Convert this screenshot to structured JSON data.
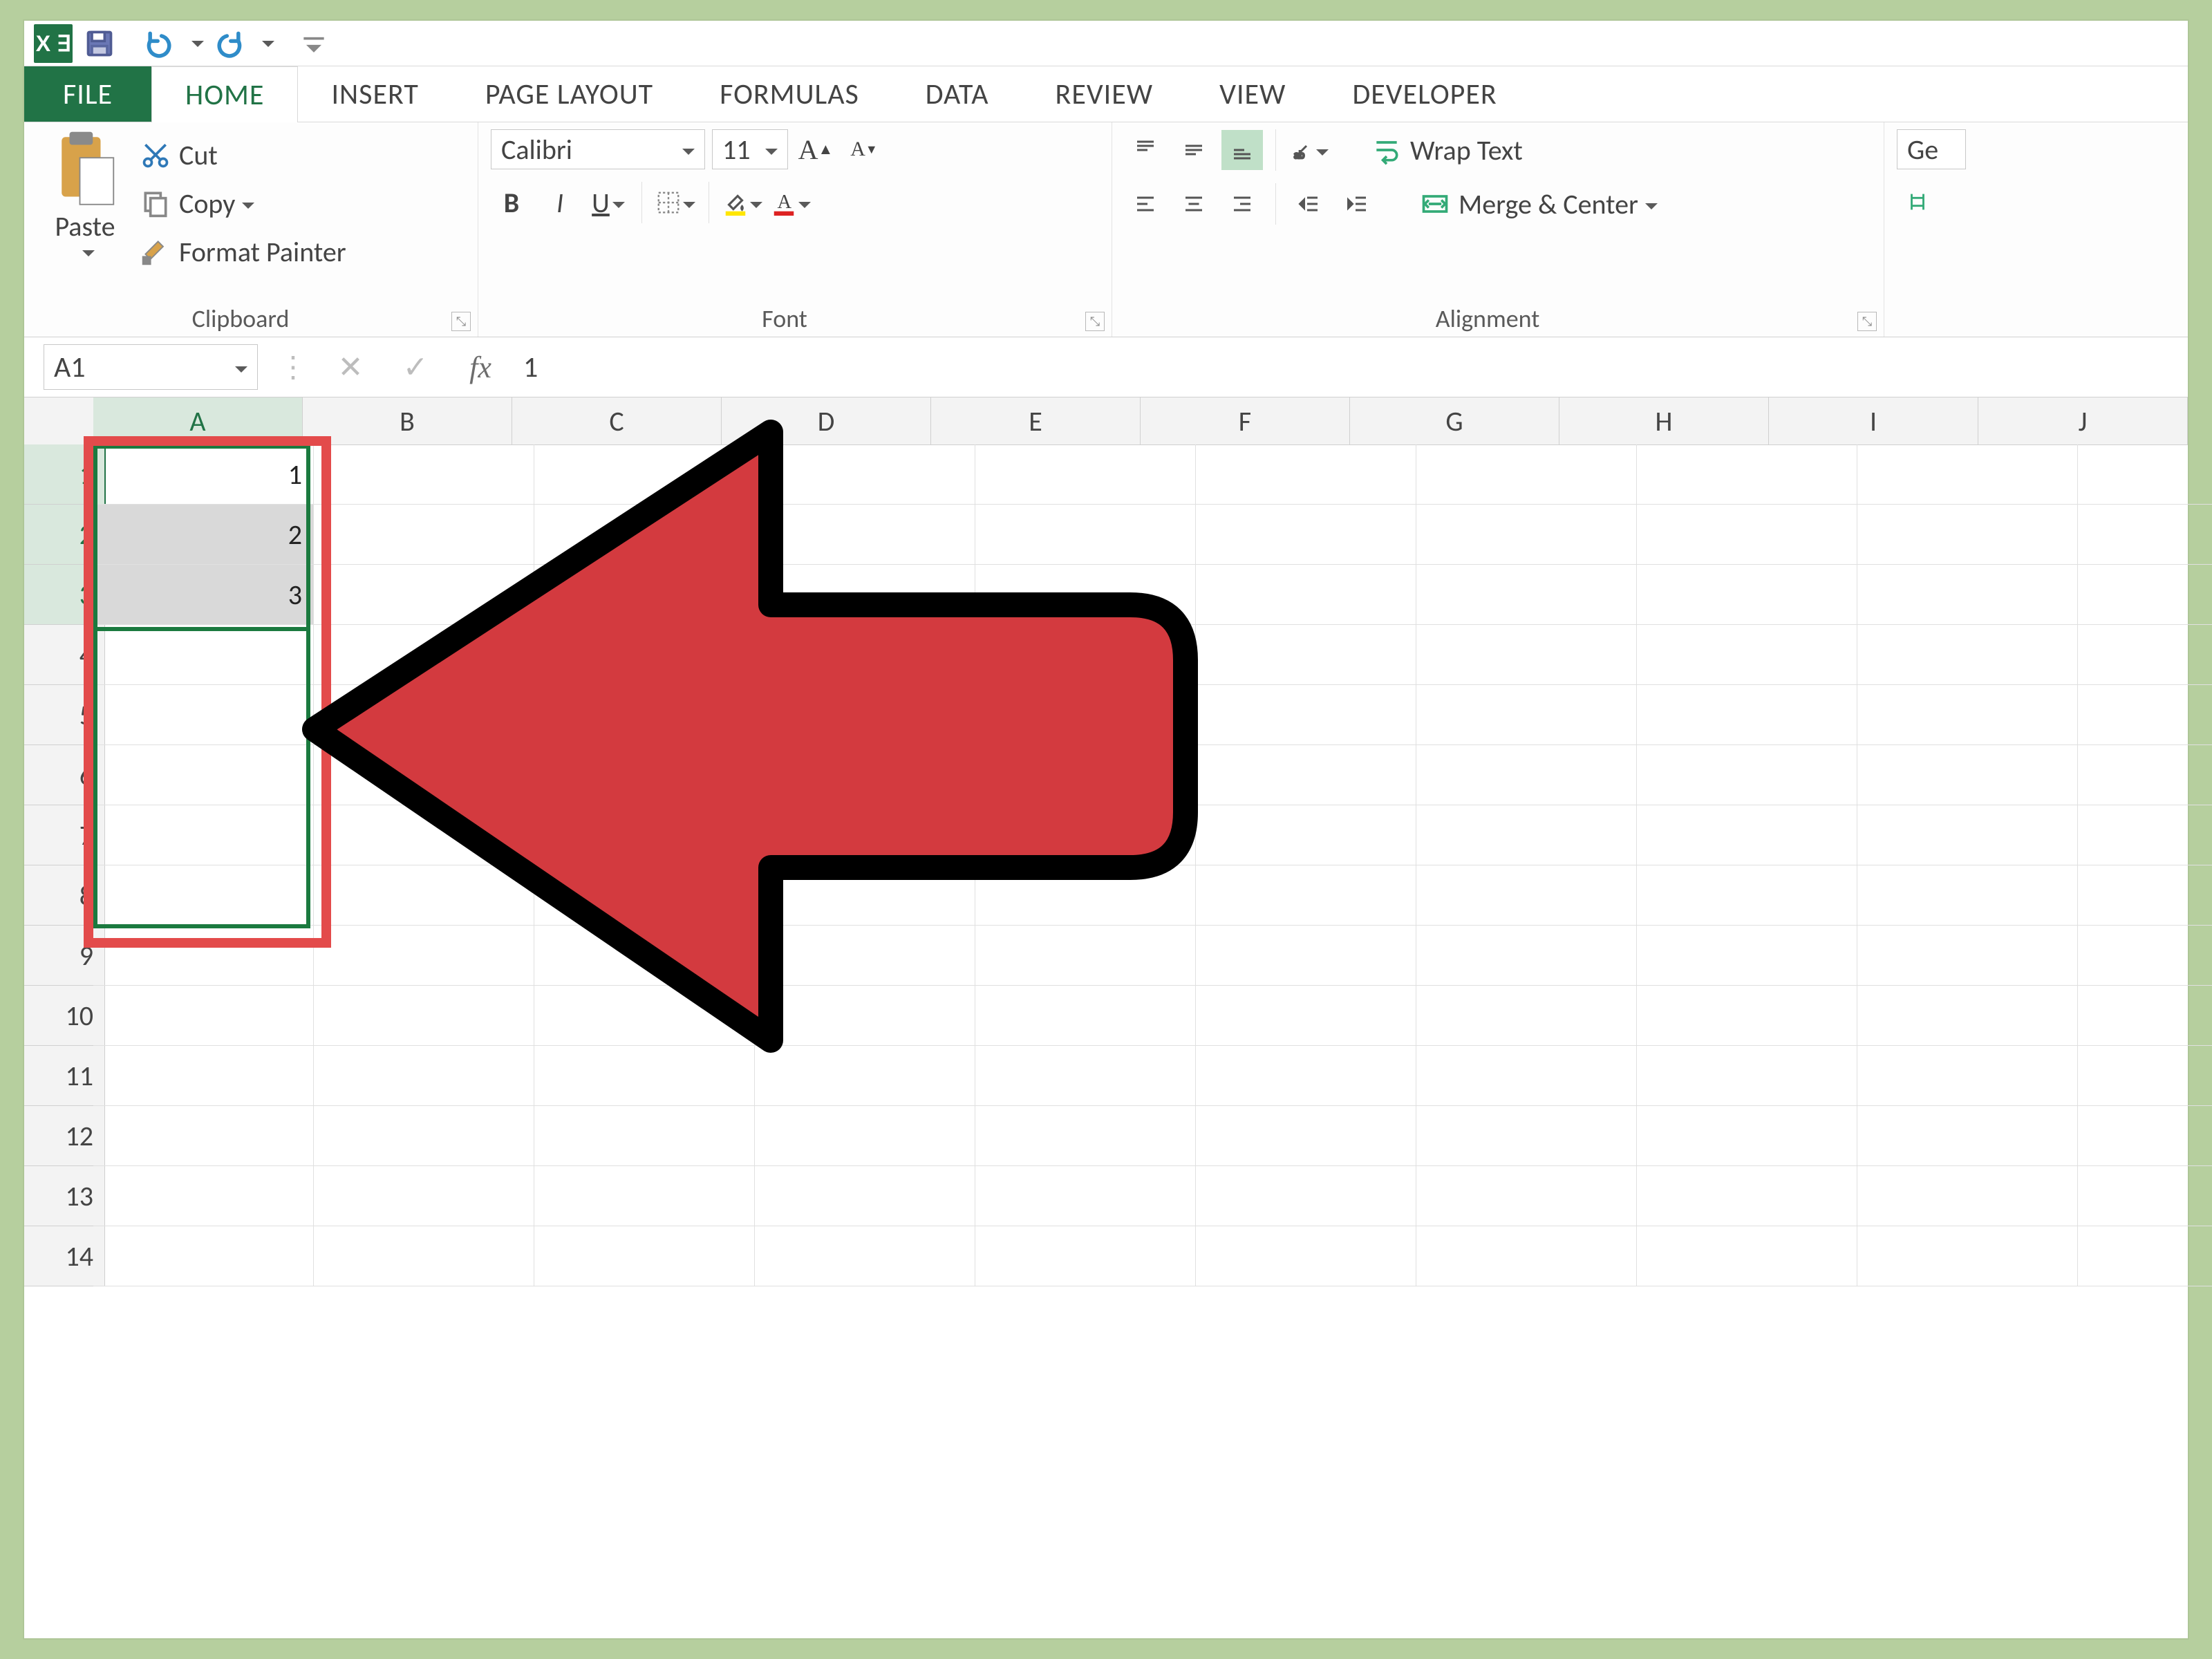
{
  "qat": {
    "save": "save",
    "undo": "undo",
    "redo": "redo"
  },
  "tabs": {
    "file": "FILE",
    "home": "HOME",
    "insert": "INSERT",
    "pagelayout": "PAGE LAYOUT",
    "formulas": "FORMULAS",
    "data": "DATA",
    "review": "REVIEW",
    "view": "VIEW",
    "developer": "DEVELOPER"
  },
  "ribbon": {
    "clipboard": {
      "paste": "Paste",
      "cut": "Cut",
      "copy": "Copy",
      "formatpainter": "Format Painter",
      "title": "Clipboard"
    },
    "font": {
      "name": "Calibri",
      "size": "11",
      "increase": "A",
      "decrease": "A",
      "title": "Font"
    },
    "alignment": {
      "wraptext": "Wrap Text",
      "merge": "Merge & Center",
      "title": "Alignment"
    },
    "number": {
      "general": "Ge"
    }
  },
  "formula_bar": {
    "namebox": "A1",
    "fx": "fx",
    "value": "1"
  },
  "columns": [
    "A",
    "B",
    "C",
    "D",
    "E",
    "F",
    "G",
    "H",
    "I",
    "J"
  ],
  "rows": [
    "1",
    "2",
    "3",
    "4",
    "5",
    "6",
    "7",
    "8",
    "9",
    "10",
    "11",
    "12",
    "13",
    "14"
  ],
  "cell_values": {
    "A1": "1",
    "A2": "2",
    "A3": "3"
  }
}
